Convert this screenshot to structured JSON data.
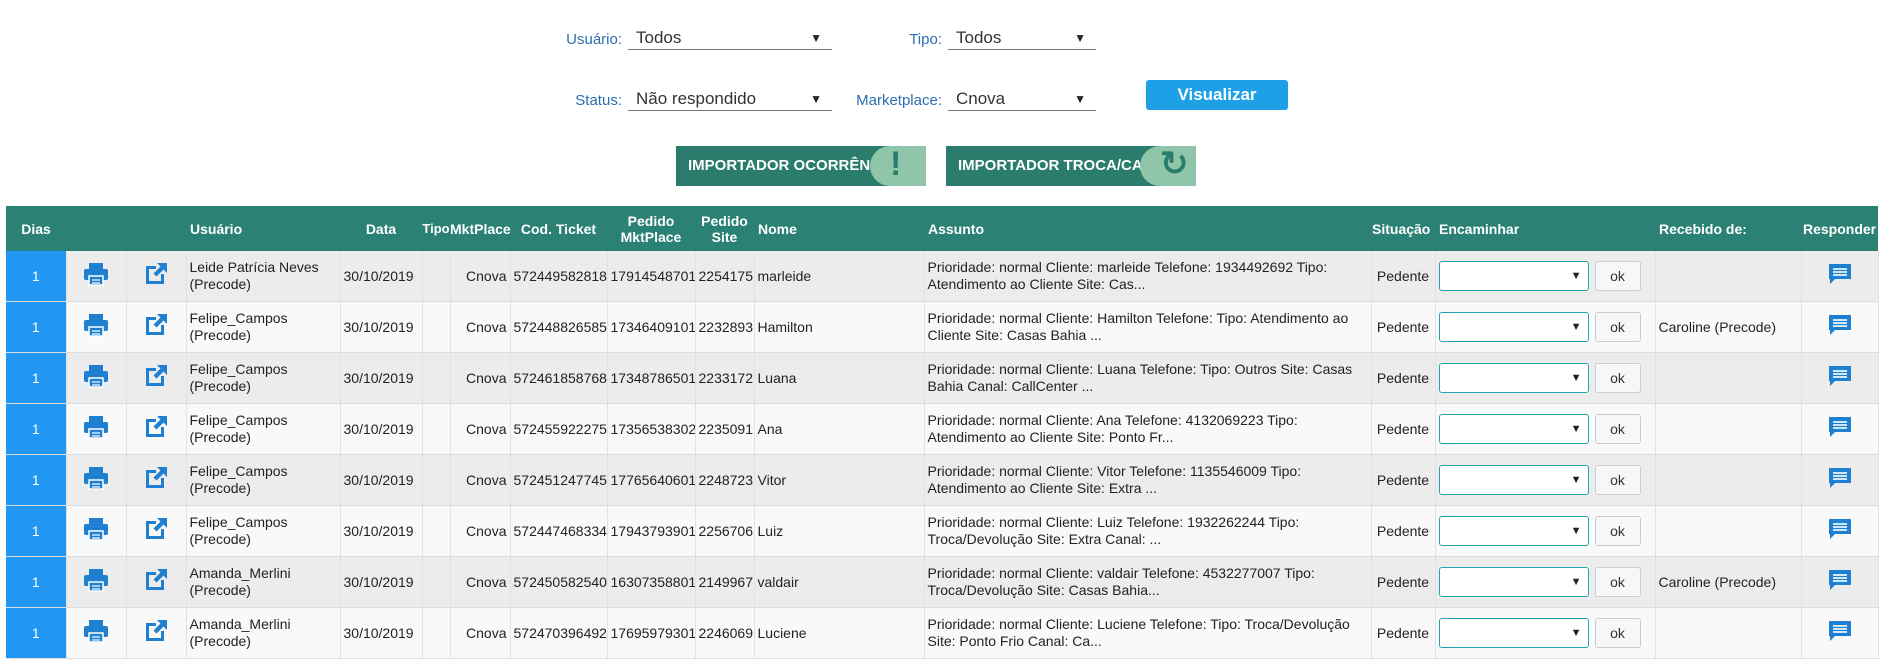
{
  "filters": {
    "usuario_label": "Usuário:",
    "usuario_value": "Todos",
    "tipo_label": "Tipo:",
    "tipo_value": "Todos",
    "status_label": "Status:",
    "status_value": "Não respondido",
    "marketplace_label": "Marketplace:",
    "marketplace_value": "Cnova",
    "visualizar_label": "Visualizar"
  },
  "importers": {
    "ocorrencia_label": "IMPORTADOR OCORRÊNCIA",
    "troca_label": "IMPORTADOR TROCA/CANC."
  },
  "table": {
    "headers": {
      "dias": "Dias",
      "usuario": "Usuário",
      "data": "Data",
      "tipo": "Tipo",
      "mktplace": "MktPlace",
      "cod_ticket": "Cod. Ticket",
      "pedido_mkt_1": "Pedido",
      "pedido_mkt_2": "MktPlace",
      "pedido_site_1": "Pedido",
      "pedido_site_2": "Site",
      "nome": "Nome",
      "assunto": "Assunto",
      "situacao": "Situação",
      "encaminhar": "Encaminhar",
      "recebido": "Recebido de:",
      "responder": "Responder"
    },
    "ok_label": "ok",
    "rows": [
      {
        "dias": "1",
        "usuario_1": "Leide Patrícia Neves",
        "usuario_2": "(Precode)",
        "data": "30/10/2019",
        "tipo": "",
        "mktplace": "Cnova",
        "cod_ticket": "572449582818",
        "pedido_mkt": "17914548701",
        "pedido_site": "2254175",
        "nome": "marleide",
        "assunto_1": "Prioridade: normal Cliente: marleide Telefone: 1934492692 Tipo:",
        "assunto_2": "Atendimento ao Cliente Site: Cas...",
        "situacao": "Pedente",
        "recebido": ""
      },
      {
        "dias": "1",
        "usuario_1": "Felipe_Campos",
        "usuario_2": "(Precode)",
        "data": "30/10/2019",
        "tipo": "",
        "mktplace": "Cnova",
        "cod_ticket": "572448826585",
        "pedido_mkt": "17346409101",
        "pedido_site": "2232893",
        "nome": "Hamilton",
        "assunto_1": "Prioridade: normal Cliente: Hamilton Telefone: Tipo: Atendimento ao",
        "assunto_2": "Cliente Site: Casas Bahia ...",
        "situacao": "Pedente",
        "recebido": "Caroline (Precode)"
      },
      {
        "dias": "1",
        "usuario_1": "Felipe_Campos",
        "usuario_2": "(Precode)",
        "data": "30/10/2019",
        "tipo": "",
        "mktplace": "Cnova",
        "cod_ticket": "572461858768",
        "pedido_mkt": "17348786501",
        "pedido_site": "2233172",
        "nome": "Luana",
        "assunto_1": "Prioridade: normal Cliente: Luana Telefone: Tipo: Outros Site: Casas",
        "assunto_2": "Bahia Canal: CallCenter ...",
        "situacao": "Pedente",
        "recebido": ""
      },
      {
        "dias": "1",
        "usuario_1": "Felipe_Campos",
        "usuario_2": "(Precode)",
        "data": "30/10/2019",
        "tipo": "",
        "mktplace": "Cnova",
        "cod_ticket": "572455922275",
        "pedido_mkt": "17356538302",
        "pedido_site": "2235091",
        "nome": "Ana",
        "assunto_1": "Prioridade: normal Cliente: Ana Telefone: 4132069223 Tipo:",
        "assunto_2": "Atendimento ao Cliente Site: Ponto Fr...",
        "situacao": "Pedente",
        "recebido": ""
      },
      {
        "dias": "1",
        "usuario_1": "Felipe_Campos",
        "usuario_2": "(Precode)",
        "data": "30/10/2019",
        "tipo": "",
        "mktplace": "Cnova",
        "cod_ticket": "572451247745",
        "pedido_mkt": "17765640601",
        "pedido_site": "2248723",
        "nome": "Vitor",
        "assunto_1": "Prioridade: normal Cliente: Vitor Telefone: 1135546009 Tipo:",
        "assunto_2": "Atendimento ao Cliente Site: Extra ...",
        "situacao": "Pedente",
        "recebido": ""
      },
      {
        "dias": "1",
        "usuario_1": "Felipe_Campos",
        "usuario_2": "(Precode)",
        "data": "30/10/2019",
        "tipo": "",
        "mktplace": "Cnova",
        "cod_ticket": "572447468334",
        "pedido_mkt": "17943793901",
        "pedido_site": "2256706",
        "nome": "Luiz",
        "assunto_1": "Prioridade: normal Cliente: Luiz Telefone: 1932262244 Tipo:",
        "assunto_2": "Troca/Devolução Site: Extra Canal: ...",
        "situacao": "Pedente",
        "recebido": ""
      },
      {
        "dias": "1",
        "usuario_1": "Amanda_Merlini",
        "usuario_2": "(Precode)",
        "data": "30/10/2019",
        "tipo": "",
        "mktplace": "Cnova",
        "cod_ticket": "572450582540",
        "pedido_mkt": "16307358801",
        "pedido_site": "2149967",
        "nome": "valdair",
        "assunto_1": "Prioridade: normal Cliente: valdair Telefone: 4532277007 Tipo:",
        "assunto_2": "Troca/Devolução Site: Casas Bahia...",
        "situacao": "Pedente",
        "recebido": "Caroline (Precode)"
      },
      {
        "dias": "1",
        "usuario_1": "Amanda_Merlini",
        "usuario_2": "(Precode)",
        "data": "30/10/2019",
        "tipo": "",
        "mktplace": "Cnova",
        "cod_ticket": "572470396492",
        "pedido_mkt": "17695979301",
        "pedido_site": "2246069",
        "nome": "Luciene",
        "assunto_1": "Prioridade: normal Cliente: Luciene Telefone: Tipo: Troca/Devolução",
        "assunto_2": "Site: Ponto Frio Canal: Ca...",
        "situacao": "Pedente",
        "recebido": ""
      }
    ]
  }
}
